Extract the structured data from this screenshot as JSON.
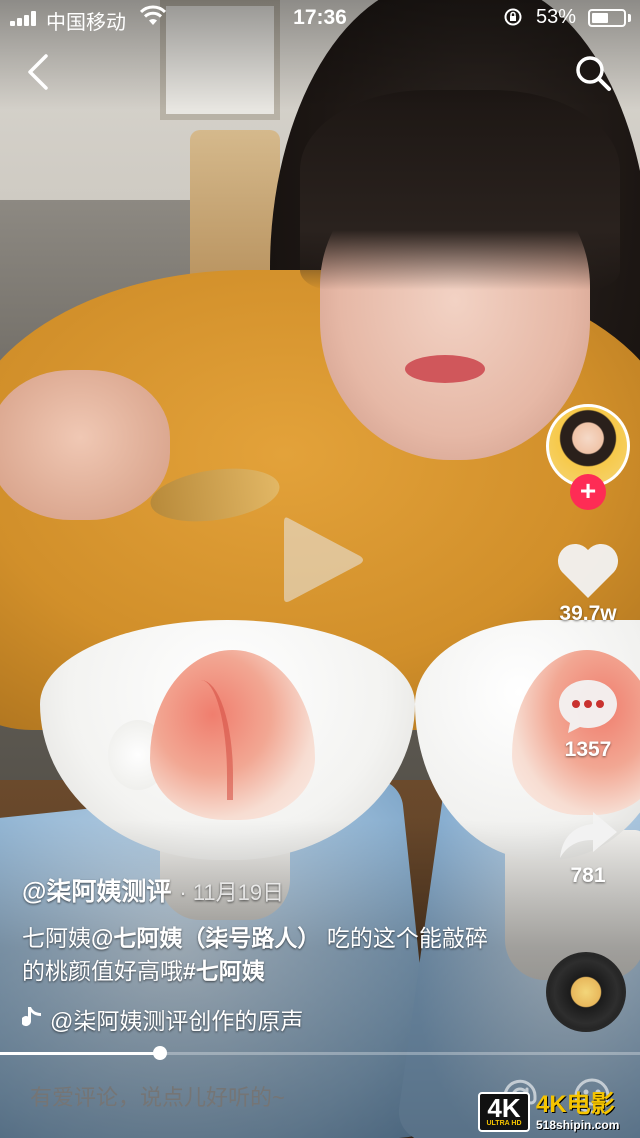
{
  "status_bar": {
    "carrier": "中国移动",
    "time": "17:36",
    "battery_percent": "53%",
    "battery_level": 0.53
  },
  "video": {
    "playback_progress": 0.25
  },
  "actions": {
    "likes": "39.7w",
    "comments": "1357",
    "shares": "781",
    "follow_label": "+"
  },
  "caption": {
    "author": "@柒阿姨测评",
    "date": "· 11月19日",
    "desc_prefix": "七阿姨",
    "mention": "@七阿姨（柒号路人）",
    "desc_body": " 吃的这个能敲碎的桃颜值好高哦",
    "hashtag": "#七阿姨",
    "music": "@柒阿姨测评创作的原声"
  },
  "comment_box": {
    "placeholder": "有爱评论，说点儿好听的~"
  },
  "watermark": {
    "badge": "4K",
    "badge_sub": "ULTRA HD",
    "brand": "4K电影",
    "url": "518shipin.com"
  },
  "icons": {
    "back": "chevron-left-icon",
    "search": "search-icon",
    "play": "play-icon",
    "like": "heart-icon",
    "comment": "comment-bubble-icon",
    "share": "share-arrow-icon",
    "music": "music-note-icon",
    "mention": "at-icon",
    "emoji": "emoji-icon"
  },
  "colors": {
    "follow": "#fe2c55",
    "watermark_brand": "#f5c400"
  }
}
